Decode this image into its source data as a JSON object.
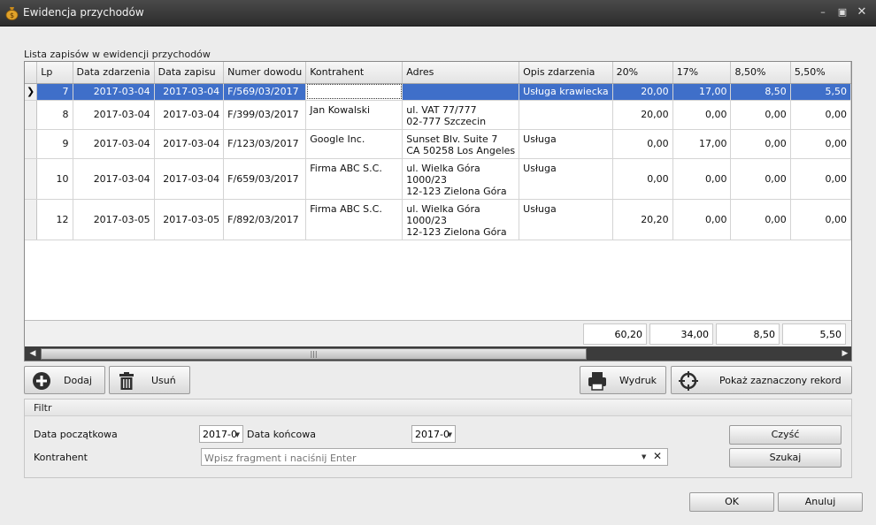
{
  "window": {
    "title": "Ewidencja przychodów"
  },
  "grid": {
    "section_label": "Lista zapisów w ewidencji przychodów",
    "columns": [
      "Lp",
      "Data zdarzenia",
      "Data zapisu",
      "Numer dowodu",
      "Kontrahent",
      "Adres",
      "Opis zdarzenia",
      "20%",
      "17%",
      "8,50%",
      "5,50%"
    ],
    "rows": [
      {
        "lp": "7",
        "data_zdarzenia": "2017-03-04",
        "data_zapisu": "2017-03-04",
        "numer": "F/569/03/2017",
        "kontrahent": "",
        "adres": [
          "",
          "",
          ""
        ],
        "opis": "Usługa krawiecka",
        "v20": "20,00",
        "v17": "17,00",
        "v85": "8,50",
        "v55": "5,50"
      },
      {
        "lp": "8",
        "data_zdarzenia": "2017-03-04",
        "data_zapisu": "2017-03-04",
        "numer": "F/399/03/2017",
        "kontrahent": "Jan Kowalski",
        "adres": [
          "ul. VAT 77/777",
          "02-777 Szczecin",
          ""
        ],
        "opis": "",
        "v20": "20,00",
        "v17": "0,00",
        "v85": "0,00",
        "v55": "0,00"
      },
      {
        "lp": "9",
        "data_zdarzenia": "2017-03-04",
        "data_zapisu": "2017-03-04",
        "numer": "F/123/03/2017",
        "kontrahent": "Google Inc.",
        "adres": [
          "Sunset Blv. Suite 7",
          "CA 50258 Los Angeles",
          ""
        ],
        "opis": "Usługa",
        "v20": "0,00",
        "v17": "17,00",
        "v85": "0,00",
        "v55": "0,00"
      },
      {
        "lp": "10",
        "data_zdarzenia": "2017-03-04",
        "data_zapisu": "2017-03-04",
        "numer": "F/659/03/2017",
        "kontrahent": "Firma ABC S.C.",
        "adres": [
          "ul. Wielka Góra",
          "1000/23",
          "12-123 Zielona Góra"
        ],
        "opis": "Usługa",
        "v20": "0,00",
        "v17": "0,00",
        "v85": "0,00",
        "v55": "0,00"
      },
      {
        "lp": "12",
        "data_zdarzenia": "2017-03-05",
        "data_zapisu": "2017-03-05",
        "numer": "F/892/03/2017",
        "kontrahent": "Firma ABC S.C.",
        "adres": [
          "ul. Wielka Góra",
          "1000/23",
          "12-123 Zielona Góra"
        ],
        "opis": "Usługa",
        "v20": "20,20",
        "v17": "0,00",
        "v85": "0,00",
        "v55": "0,00"
      }
    ],
    "totals": {
      "v20": "60,20",
      "v17": "34,00",
      "v85": "8,50",
      "v55": "5,50"
    }
  },
  "toolbar": {
    "add": "Dodaj",
    "delete": "Usuń",
    "print": "Wydruk",
    "show_selected": "Pokaż zaznaczony rekord"
  },
  "filter": {
    "title": "Filtr",
    "start_date_label": "Data początkowa",
    "start_date_value": "2017-0",
    "end_date_label": "Data końcowa",
    "end_date_value": "2017-0",
    "contractor_label": "Kontrahent",
    "contractor_placeholder": "Wpisz fragment i naciśnij Enter",
    "clear": "Czyść",
    "search": "Szukaj"
  },
  "dialog": {
    "ok": "OK",
    "cancel": "Anuluj"
  }
}
